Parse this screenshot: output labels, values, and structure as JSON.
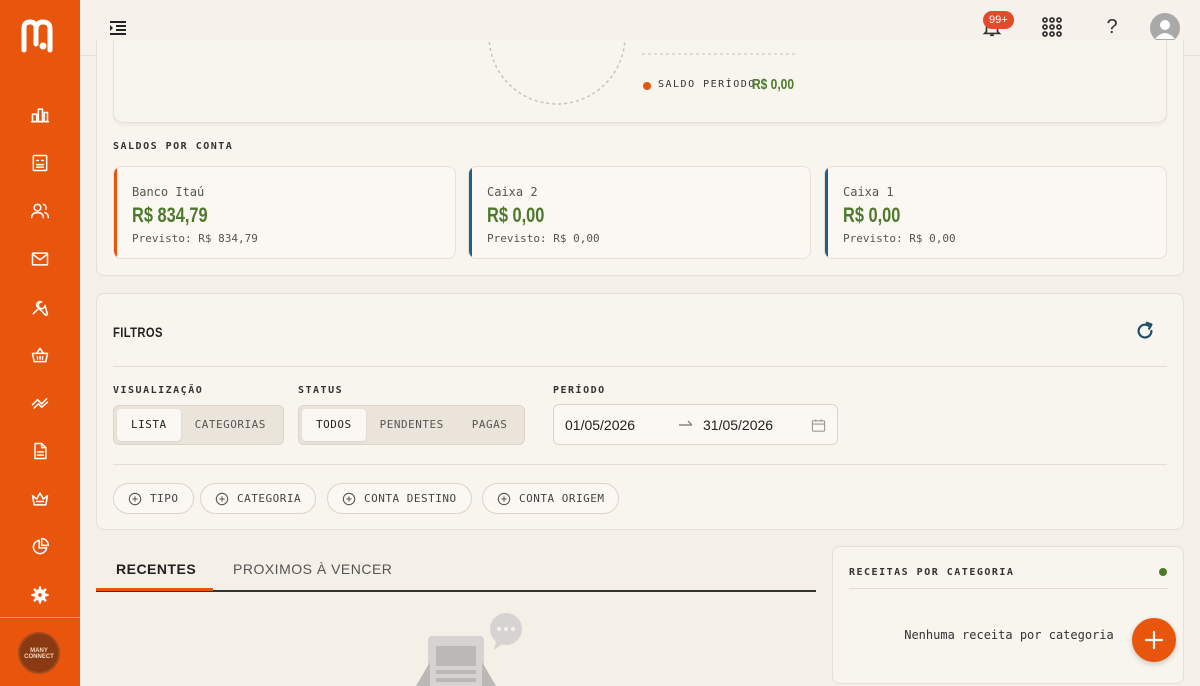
{
  "brand": {
    "logo_text": "m",
    "avatar_text": "MANY CONNECT",
    "accent": "#e8560d",
    "positive": "#4c7a2a"
  },
  "sidebar": {
    "items": [
      {
        "icon": "dashboard-icon"
      },
      {
        "icon": "receipt-icon"
      },
      {
        "icon": "users-icon"
      },
      {
        "icon": "mail-icon"
      },
      {
        "icon": "tools-icon"
      },
      {
        "icon": "basket-icon"
      },
      {
        "icon": "delivery-icon"
      },
      {
        "icon": "document-icon"
      },
      {
        "icon": "crown-icon"
      },
      {
        "icon": "pie-chart-icon"
      },
      {
        "icon": "settings-icon"
      }
    ]
  },
  "topbar": {
    "notifications_badge": "99+",
    "help_label": "?"
  },
  "summary": {
    "legend_label": "SALDO PERÍODO",
    "legend_value": "R$ 0,00"
  },
  "accounts": {
    "section_label": "SALDOS POR CONTA",
    "items": [
      {
        "name": "Banco Itaú",
        "value": "R$ 834,79",
        "forecast": "Previsto: R$ 834,79",
        "color": "#e8560d"
      },
      {
        "name": "Caixa 2",
        "value": "R$ 0,00",
        "forecast": "Previsto: R$ 0,00",
        "color": "#1f5f8b"
      },
      {
        "name": "Caixa 1",
        "value": "R$ 0,00",
        "forecast": "Previsto: R$ 0,00",
        "color": "#1f5f8b"
      }
    ]
  },
  "filters": {
    "title": "FILTROS",
    "visualization": {
      "label": "VISUALIZAÇÃO",
      "options": [
        "LISTA",
        "CATEGORIAS"
      ],
      "selected": "LISTA"
    },
    "status": {
      "label": "STATUS",
      "options": [
        "TODOS",
        "PENDENTES",
        "PAGAS"
      ],
      "selected": "TODOS"
    },
    "period": {
      "label": "PERÍODO",
      "start": "01/05/2026",
      "end": "31/05/2026"
    },
    "chips": [
      "TIPO",
      "CATEGORIA",
      "CONTA DESTINO",
      "CONTA ORIGEM"
    ]
  },
  "tabs": {
    "items": [
      "RECENTES",
      "PROXIMOS À VENCER"
    ],
    "active": "RECENTES"
  },
  "category_card": {
    "title": "RECEITAS POR CATEGORIA",
    "empty_text": "Nenhuma receita por categoria"
  }
}
